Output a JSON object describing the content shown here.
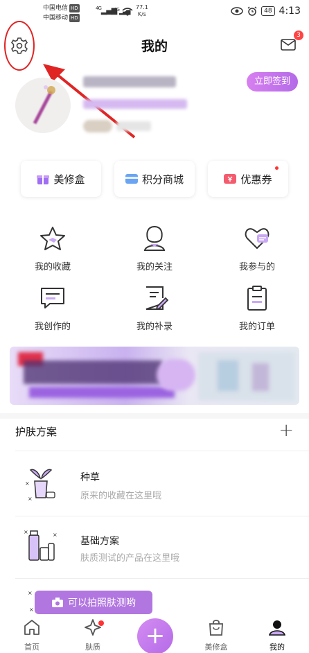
{
  "status_bar": {
    "carrier1": "中国电信",
    "carrier2": "中国移动",
    "hd": "HD",
    "signal1": "4G",
    "signal2": "4G",
    "speed_value": "77.1",
    "speed_unit": "K/s",
    "battery": "48",
    "time": "4:13"
  },
  "header": {
    "title": "我的",
    "mail_badge": "3"
  },
  "profile": {
    "checkin_label": "立即签到"
  },
  "shortcuts": [
    {
      "label": "美修盒",
      "icon": "gift-box-icon",
      "color": "#9b6cf0"
    },
    {
      "label": "积分商城",
      "icon": "card-icon",
      "color": "#6aa4f3"
    },
    {
      "label": "优惠券",
      "icon": "coupon-icon",
      "color": "#f45c6e"
    }
  ],
  "grid": [
    {
      "label": "我的收藏",
      "icon": "star-icon"
    },
    {
      "label": "我的关注",
      "icon": "person-icon"
    },
    {
      "label": "我参与的",
      "icon": "heart-chat-icon"
    },
    {
      "label": "我创作的",
      "icon": "message-icon"
    },
    {
      "label": "我的补录",
      "icon": "edit-note-icon"
    },
    {
      "label": "我的订单",
      "icon": "clipboard-icon"
    }
  ],
  "skincare": {
    "title": "护肤方案",
    "items": [
      {
        "title": "种草",
        "desc": "原来的收藏在这里哦"
      },
      {
        "title": "基础方案",
        "desc": "肤质测试的产品在这里哦"
      }
    ]
  },
  "camera_tip": "可以拍照肤测哟",
  "bottom_nav": [
    {
      "label": "首页",
      "icon": "home-icon"
    },
    {
      "label": "肤质",
      "icon": "sparkle-icon"
    },
    {
      "label": "美修盒",
      "icon": "bag-icon"
    },
    {
      "label": "我的",
      "icon": "profile-icon"
    }
  ],
  "colors": {
    "accent": "#b46be8",
    "annotation": "#e02424"
  }
}
